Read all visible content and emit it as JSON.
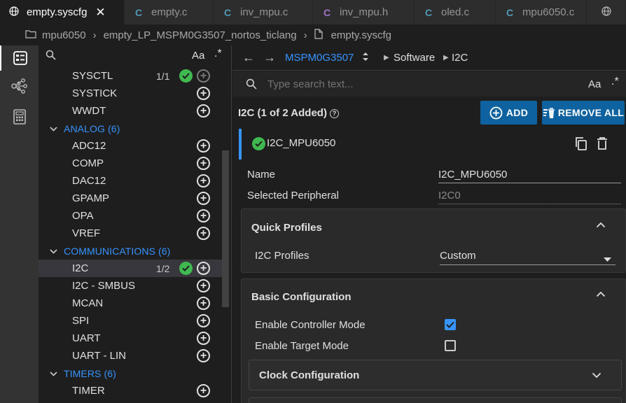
{
  "tabs": [
    {
      "label": "empty.syscfg",
      "icon": "globe-icon",
      "active": true,
      "closable": true
    },
    {
      "label": "empty.c",
      "icon": "c-file-icon",
      "color": "#519aba"
    },
    {
      "label": "inv_mpu.c",
      "icon": "c-file-icon",
      "color": "#519aba"
    },
    {
      "label": "inv_mpu.h",
      "icon": "h-file-icon",
      "color": "#a074c4"
    },
    {
      "label": "oled.c",
      "icon": "c-file-icon",
      "color": "#519aba"
    },
    {
      "label": "mpu6050.c",
      "icon": "c-file-icon",
      "color": "#519aba"
    }
  ],
  "breadcrumb": {
    "folder": "mpu6050",
    "project": "empty_LP_MSPM0G3507_nortos_ticlang",
    "file": "empty.syscfg"
  },
  "tree": {
    "search_case_label": "Aa",
    "rows": [
      {
        "kind": "item",
        "label": "SYSCTL",
        "count": "1/1",
        "added": true,
        "dim_plus": true
      },
      {
        "kind": "item",
        "label": "SYSTICK"
      },
      {
        "kind": "item",
        "label": "WWDT"
      },
      {
        "kind": "cat",
        "label": "ANALOG (6)"
      },
      {
        "kind": "item",
        "label": "ADC12"
      },
      {
        "kind": "item",
        "label": "COMP"
      },
      {
        "kind": "item",
        "label": "DAC12"
      },
      {
        "kind": "item",
        "label": "GPAMP"
      },
      {
        "kind": "item",
        "label": "OPA"
      },
      {
        "kind": "item",
        "label": "VREF"
      },
      {
        "kind": "cat",
        "label": "COMMUNICATIONS (6)"
      },
      {
        "kind": "item",
        "label": "I2C",
        "count": "1/2",
        "added": true,
        "selected": true
      },
      {
        "kind": "item",
        "label": "I2C - SMBUS"
      },
      {
        "kind": "item",
        "label": "MCAN"
      },
      {
        "kind": "item",
        "label": "SPI"
      },
      {
        "kind": "item",
        "label": "UART"
      },
      {
        "kind": "item",
        "label": "UART - LIN"
      },
      {
        "kind": "cat",
        "label": "TIMERS (6)"
      },
      {
        "kind": "item",
        "label": "TIMER"
      }
    ]
  },
  "nav": {
    "device": "MSPM0G3507",
    "crumb1": "Software",
    "crumb2": "I2C"
  },
  "panel_search": {
    "placeholder": "Type search text...",
    "case_label": "Aa"
  },
  "module": {
    "title": "I2C (1 of 2 Added)",
    "add_label": "ADD",
    "remove_label": "REMOVE ALL",
    "instance_name": "I2C_MPU6050",
    "fields": {
      "name_label": "Name",
      "name_value": "I2C_MPU6050",
      "periph_label": "Selected Peripheral",
      "periph_value": "I2C0"
    }
  },
  "quick_profiles": {
    "title": "Quick Profiles",
    "profile_label": "I2C Profiles",
    "profile_value": "Custom"
  },
  "basic_config": {
    "title": "Basic Configuration",
    "controller_label": "Enable Controller Mode",
    "controller_checked": true,
    "target_label": "Enable Target Mode",
    "target_checked": false,
    "clock_title": "Clock Configuration"
  },
  "colors": {
    "accent": "#3794ff",
    "button": "#0f62a0",
    "success": "#3fb950"
  }
}
